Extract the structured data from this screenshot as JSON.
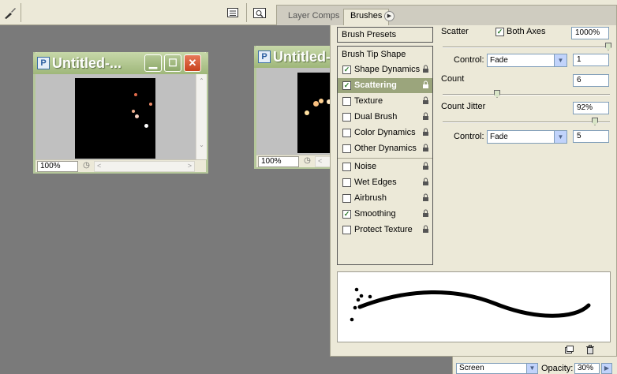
{
  "well": {
    "tabs": [
      {
        "label": "Layer Comps"
      },
      {
        "label": "Brushes"
      }
    ]
  },
  "documents": [
    {
      "title": "Untitled-...",
      "zoom": "100%"
    },
    {
      "title": "Untitled-",
      "zoom": "100%"
    }
  ],
  "brushes": {
    "presets_label": "Brush Presets",
    "tip_shape_label": "Brush Tip Shape",
    "options": [
      {
        "label": "Shape Dynamics",
        "checked": true
      },
      {
        "label": "Scattering",
        "checked": true,
        "selected": true
      },
      {
        "label": "Texture",
        "checked": false
      },
      {
        "label": "Dual Brush",
        "checked": false
      },
      {
        "label": "Color Dynamics",
        "checked": false
      },
      {
        "label": "Other Dynamics",
        "checked": false
      },
      {
        "label": "Noise",
        "checked": false
      },
      {
        "label": "Wet Edges",
        "checked": false
      },
      {
        "label": "Airbrush",
        "checked": false
      },
      {
        "label": "Smoothing",
        "checked": true
      },
      {
        "label": "Protect Texture",
        "checked": false
      }
    ],
    "scatter": {
      "label": "Scatter",
      "both_axes_label": "Both Axes",
      "both_axes_checked": true,
      "value": "1000%",
      "slider_level": 1.0,
      "control_label": "Control:",
      "control_value": "Fade",
      "fade_steps": "1"
    },
    "count": {
      "label": "Count",
      "value": "6",
      "slider_level": 0.37
    },
    "count_jitter": {
      "label": "Count Jitter",
      "value": "92%",
      "slider_level": 0.92,
      "control_label": "Control:",
      "control_value": "Fade",
      "fade_steps": "5"
    }
  },
  "layers": {
    "blend_mode": "Screen",
    "opacity_label": "Opacity:",
    "opacity_value": "30%"
  },
  "icons": {
    "minimize": "minimize-icon",
    "maximize": "maximize-icon",
    "close": "close-icon",
    "lock": "lock-icon",
    "new_brush": "new-brush-icon",
    "trash": "trash-icon"
  },
  "colors": {
    "selection": "#9ba57c",
    "titlebar": "#9fb77a",
    "workspace": "#7a7a7a"
  }
}
